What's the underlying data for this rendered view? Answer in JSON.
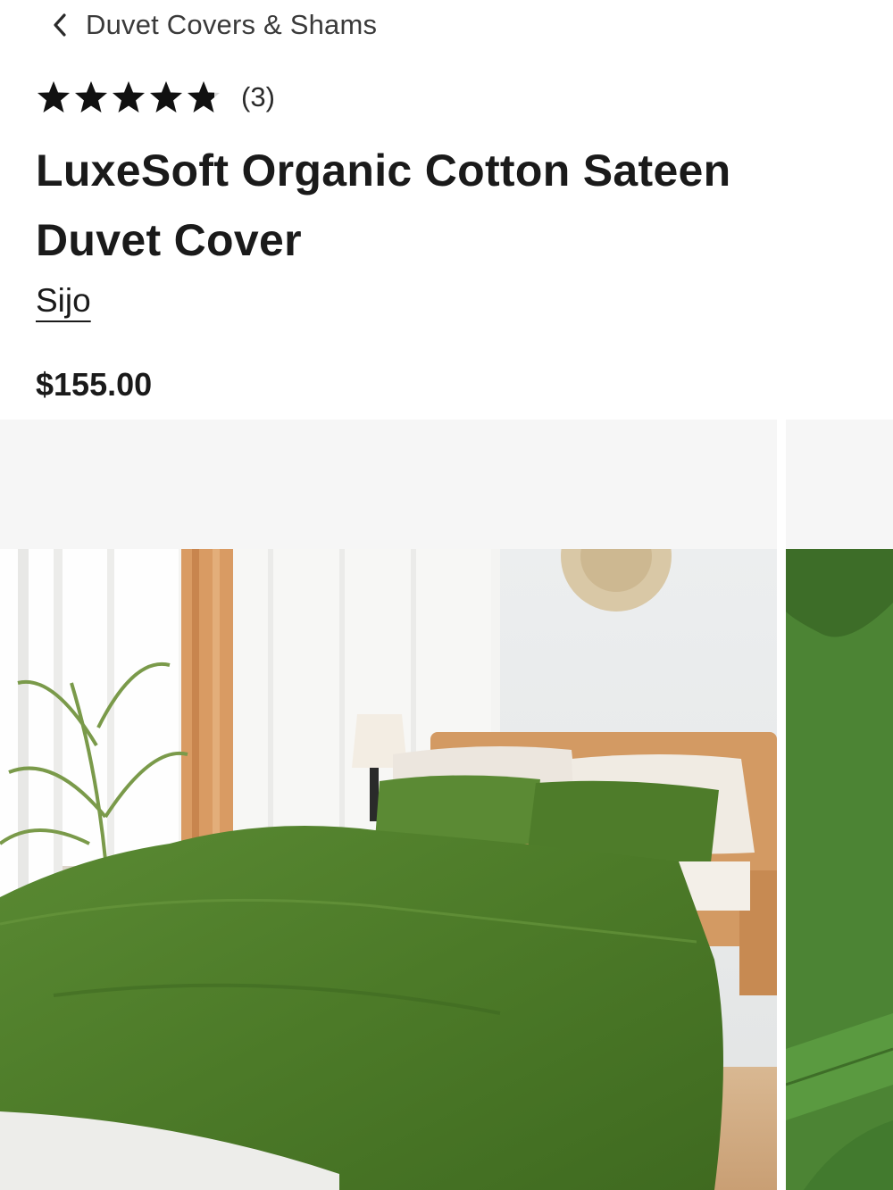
{
  "breadcrumb": {
    "label": "Duvet Covers & Shams",
    "icon": "chevron-left-icon"
  },
  "rating": {
    "value": 4.8,
    "max": 5,
    "count_label": "(3)"
  },
  "product": {
    "title": "LuxeSoft Organic Cotton Sateen Duvet Cover",
    "brand": "Sijo",
    "price": "$155.00"
  },
  "gallery": {
    "images": [
      {
        "name": "product-image-bedroom",
        "color": "#4f7a2b"
      },
      {
        "name": "product-image-fabric-closeup",
        "color": "#4c8434"
      }
    ]
  },
  "colors": {
    "text": "#1a1a1a",
    "muted": "#3a3a3a",
    "gallery_bg": "#f6f6f6",
    "duvet_green": "#4f7a2b"
  }
}
